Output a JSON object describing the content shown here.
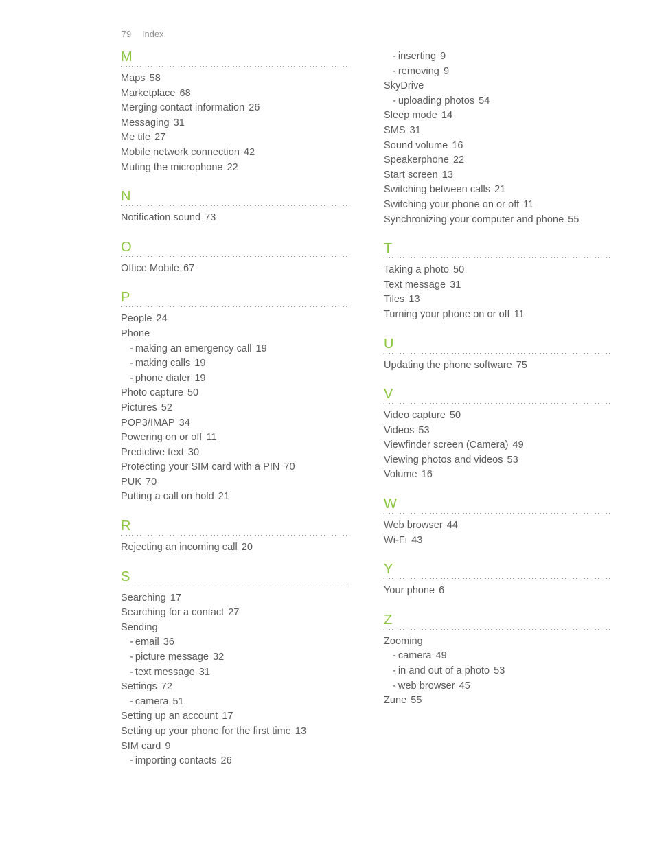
{
  "header": {
    "folio": "79",
    "title": "Index"
  },
  "theme": {
    "letter_color": "#8dc63f",
    "text_color": "#5b5b5b",
    "header_color": "#8e8e8e",
    "rule_color": "#9a9a9a",
    "background": "#ffffff"
  },
  "columns": [
    {
      "name": "left-column",
      "sections": [
        {
          "letter": "M",
          "entries": [
            {
              "text": "Maps",
              "page": "58",
              "sub": false
            },
            {
              "text": "Marketplace",
              "page": "68",
              "sub": false
            },
            {
              "text": "Merging contact information",
              "page": "26",
              "sub": false
            },
            {
              "text": "Messaging",
              "page": "31",
              "sub": false
            },
            {
              "text": "Me tile",
              "page": "27",
              "sub": false
            },
            {
              "text": "Mobile network connection",
              "page": "42",
              "sub": false
            },
            {
              "text": "Muting the microphone",
              "page": "22",
              "sub": false
            }
          ]
        },
        {
          "letter": "N",
          "entries": [
            {
              "text": "Notification sound",
              "page": "73",
              "sub": false
            }
          ]
        },
        {
          "letter": "O",
          "entries": [
            {
              "text": "Office Mobile",
              "page": "67",
              "sub": false
            }
          ]
        },
        {
          "letter": "P",
          "entries": [
            {
              "text": "People",
              "page": "24",
              "sub": false
            },
            {
              "text": "Phone",
              "page": "",
              "sub": false
            },
            {
              "text": "making an emergency call",
              "page": "19",
              "sub": true
            },
            {
              "text": "making calls",
              "page": "19",
              "sub": true
            },
            {
              "text": "phone dialer",
              "page": "19",
              "sub": true
            },
            {
              "text": "Photo capture",
              "page": "50",
              "sub": false
            },
            {
              "text": "Pictures",
              "page": "52",
              "sub": false
            },
            {
              "text": "POP3/IMAP",
              "page": "34",
              "sub": false
            },
            {
              "text": "Powering on or off",
              "page": "11",
              "sub": false
            },
            {
              "text": "Predictive text",
              "page": "30",
              "sub": false
            },
            {
              "text": "Protecting your SIM card with a PIN",
              "page": "70",
              "sub": false
            },
            {
              "text": "PUK",
              "page": "70",
              "sub": false
            },
            {
              "text": "Putting a call on hold",
              "page": "21",
              "sub": false
            }
          ]
        },
        {
          "letter": "R",
          "entries": [
            {
              "text": "Rejecting an incoming call",
              "page": "20",
              "sub": false
            }
          ]
        },
        {
          "letter": "S",
          "entries": [
            {
              "text": "Searching",
              "page": "17",
              "sub": false
            },
            {
              "text": "Searching for a contact",
              "page": "27",
              "sub": false
            },
            {
              "text": "Sending",
              "page": "",
              "sub": false
            },
            {
              "text": "email",
              "page": "36",
              "sub": true
            },
            {
              "text": "picture message",
              "page": "32",
              "sub": true
            },
            {
              "text": "text message",
              "page": "31",
              "sub": true
            },
            {
              "text": "Settings",
              "page": "72",
              "sub": false
            },
            {
              "text": "camera",
              "page": "51",
              "sub": true
            },
            {
              "text": "Setting up an account",
              "page": "17",
              "sub": false
            },
            {
              "text": "Setting up your phone for the first time",
              "page": "13",
              "sub": false
            },
            {
              "text": "SIM card",
              "page": "9",
              "sub": false
            },
            {
              "text": "importing contacts",
              "page": "26",
              "sub": true
            }
          ]
        }
      ]
    },
    {
      "name": "right-column",
      "sections": [
        {
          "letter": "",
          "entries": [
            {
              "text": "inserting",
              "page": "9",
              "sub": true
            },
            {
              "text": "removing",
              "page": "9",
              "sub": true
            },
            {
              "text": "SkyDrive",
              "page": "",
              "sub": false
            },
            {
              "text": "uploading photos",
              "page": "54",
              "sub": true
            },
            {
              "text": "Sleep mode",
              "page": "14",
              "sub": false
            },
            {
              "text": "SMS",
              "page": "31",
              "sub": false
            },
            {
              "text": "Sound volume",
              "page": "16",
              "sub": false
            },
            {
              "text": "Speakerphone",
              "page": "22",
              "sub": false
            },
            {
              "text": "Start screen",
              "page": "13",
              "sub": false
            },
            {
              "text": "Switching between calls",
              "page": "21",
              "sub": false
            },
            {
              "text": "Switching your phone on or off",
              "page": "11",
              "sub": false
            },
            {
              "text": "Synchronizing your computer and phone",
              "page": "55",
              "sub": false
            }
          ]
        },
        {
          "letter": "T",
          "entries": [
            {
              "text": "Taking a photo",
              "page": "50",
              "sub": false
            },
            {
              "text": "Text message",
              "page": "31",
              "sub": false
            },
            {
              "text": "Tiles",
              "page": "13",
              "sub": false
            },
            {
              "text": "Turning your phone on or off",
              "page": "11",
              "sub": false
            }
          ]
        },
        {
          "letter": "U",
          "entries": [
            {
              "text": "Updating the phone software",
              "page": "75",
              "sub": false
            }
          ]
        },
        {
          "letter": "V",
          "entries": [
            {
              "text": "Video capture",
              "page": "50",
              "sub": false
            },
            {
              "text": "Videos",
              "page": "53",
              "sub": false
            },
            {
              "text": "Viewfinder screen (Camera)",
              "page": "49",
              "sub": false
            },
            {
              "text": "Viewing photos and videos",
              "page": "53",
              "sub": false
            },
            {
              "text": "Volume",
              "page": "16",
              "sub": false
            }
          ]
        },
        {
          "letter": "W",
          "entries": [
            {
              "text": "Web browser",
              "page": "44",
              "sub": false
            },
            {
              "text": "Wi-Fi",
              "page": "43",
              "sub": false
            }
          ]
        },
        {
          "letter": "Y",
          "entries": [
            {
              "text": "Your phone",
              "page": "6",
              "sub": false
            }
          ]
        },
        {
          "letter": "Z",
          "entries": [
            {
              "text": "Zooming",
              "page": "",
              "sub": false
            },
            {
              "text": "camera",
              "page": "49",
              "sub": true
            },
            {
              "text": "in and out of a photo",
              "page": "53",
              "sub": true
            },
            {
              "text": "web browser",
              "page": "45",
              "sub": true
            },
            {
              "text": "Zune",
              "page": "55",
              "sub": false
            }
          ]
        }
      ]
    }
  ]
}
